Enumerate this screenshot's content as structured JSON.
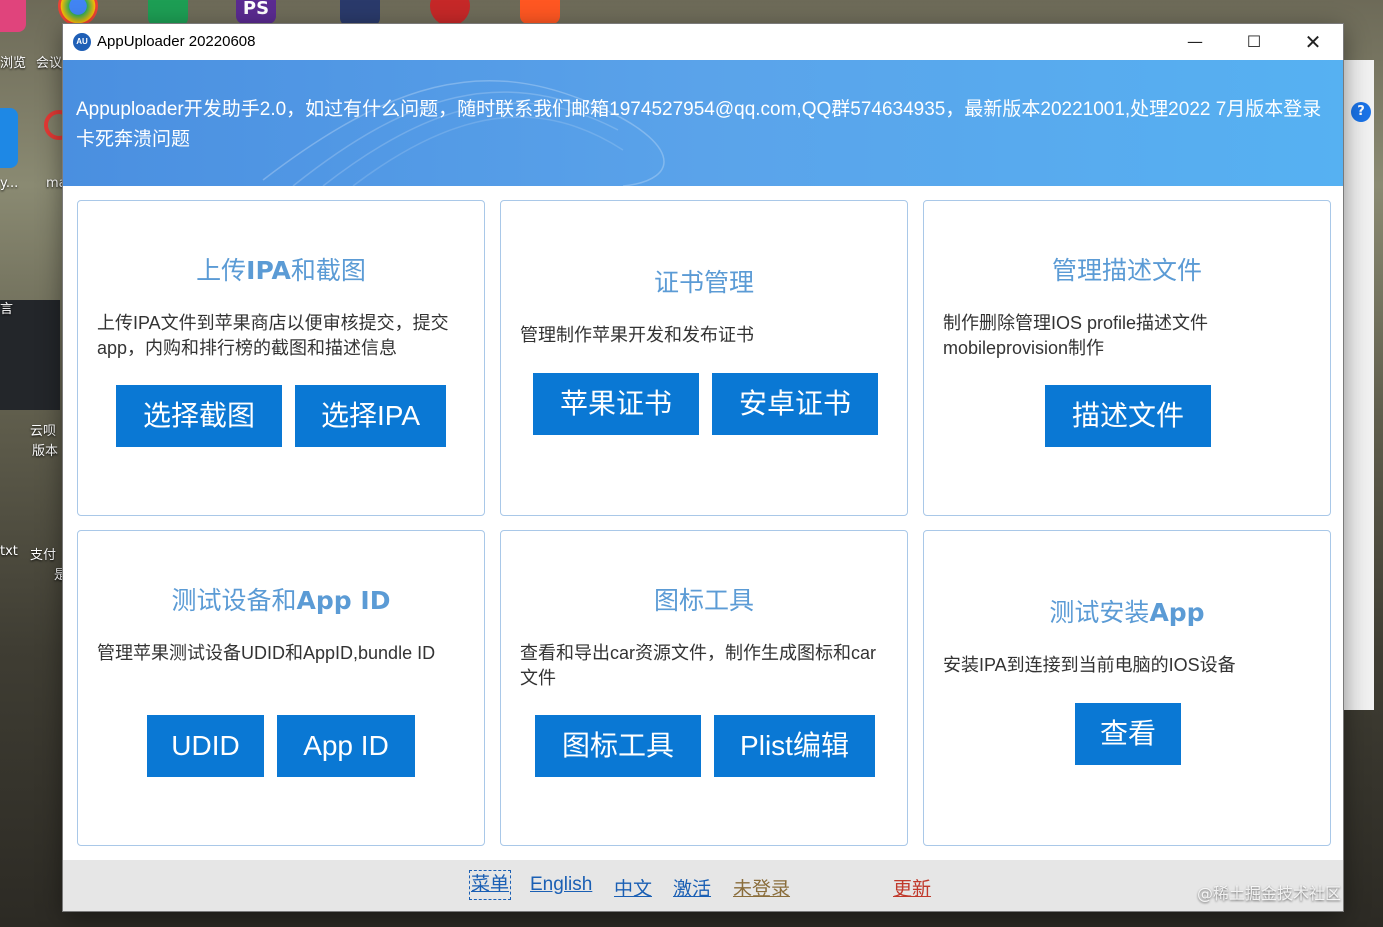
{
  "window": {
    "title": "AppUploader 20220608",
    "app_icon_text": "AU"
  },
  "banner": {
    "text": "Appuploader开发助手2.0，如过有什么问题，随时联系我们邮箱1974527954@qq.com,QQ群574634935，最新版本20221001,处理2022 7月版本登录卡死奔溃问题"
  },
  "cards": [
    {
      "title_a": "上传",
      "title_b": "IPA",
      "title_c": "和截图",
      "desc": "上传IPA文件到苹果商店以便审核提交，提交app，内购和排行榜的截图和描述信息",
      "buttons": [
        "选择截图",
        "选择IPA"
      ]
    },
    {
      "title_a": "证书管理",
      "title_b": "",
      "title_c": "",
      "desc": "管理制作苹果开发和发布证书",
      "buttons": [
        "苹果证书",
        "安卓证书"
      ]
    },
    {
      "title_a": "管理描述文件",
      "title_b": "",
      "title_c": "",
      "desc": "制作删除管理IOS profile描述文件mobileprovision制作",
      "buttons": [
        "描述文件"
      ]
    },
    {
      "title_a": "测试设备和",
      "title_b": "App ID",
      "title_c": "",
      "desc": "管理苹果测试设备UDID和AppID,bundle ID",
      "buttons": [
        "UDID",
        "App ID"
      ]
    },
    {
      "title_a": "图标工具",
      "title_b": "",
      "title_c": "",
      "desc": "查看和导出car资源文件，制作生成图标和car文件",
      "buttons": [
        "图标工具",
        "Plist编辑"
      ]
    },
    {
      "title_a": "测试安装",
      "title_b": "App",
      "title_c": "",
      "desc": "安装IPA到连接到当前电脑的IOS设备",
      "buttons": [
        "查看"
      ]
    }
  ],
  "footer": {
    "links": [
      "菜单",
      "English",
      "中文",
      "激活",
      "未登录",
      "更新"
    ],
    "colors": {
      "link": "#1a5fb4",
      "status": "#8a6d3b",
      "update": "#c0392b"
    }
  },
  "desktop": {
    "labels": [
      "浏览",
      "会议",
      "y...",
      "ma",
      "言",
      "云呗",
      "版本",
      "txt",
      "支付",
      "是"
    ],
    "watermark": "@稀土掘金技术社区"
  },
  "colors": {
    "accent": "#0a78d4",
    "title_blue": "#5b9bd5",
    "banner_start": "#4a8fe0",
    "banner_end": "#56b1f2"
  }
}
